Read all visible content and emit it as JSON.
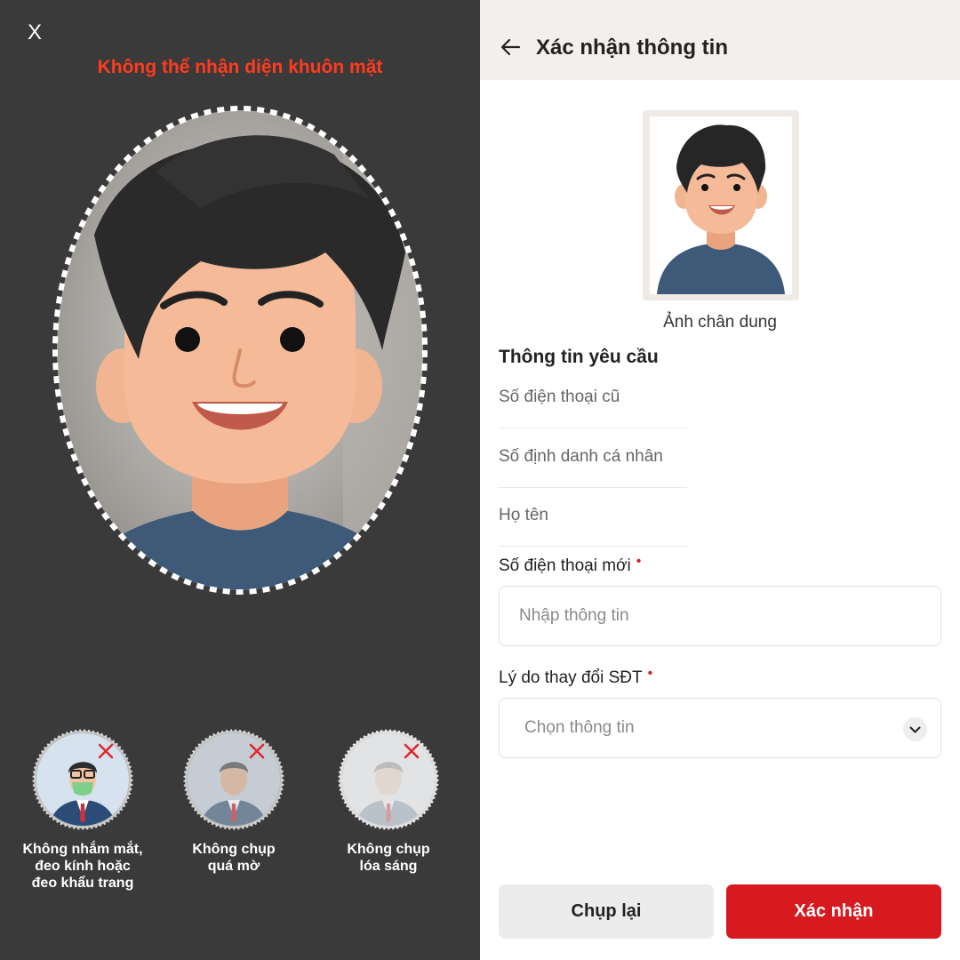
{
  "capture": {
    "close_label": "X",
    "error_message": "Không thể nhận diện khuôn mặt",
    "tips": [
      {
        "label_lines": [
          "Không nhắm mắt,",
          "đeo kính hoặc",
          "đeo khẩu trang"
        ],
        "icon": "masked-person-icon"
      },
      {
        "label_lines": [
          "Không chụp",
          "quá mờ"
        ],
        "icon": "blurry-person-icon"
      },
      {
        "label_lines": [
          "Không chụp",
          "lóa sáng"
        ],
        "icon": "glare-person-icon"
      }
    ]
  },
  "header": {
    "title": "Xác nhận thông tin",
    "back_icon": "arrow-left-icon"
  },
  "portrait": {
    "caption": "Ảnh chân dung"
  },
  "form": {
    "section_title": "Thông tin yêu cầu",
    "info_rows": [
      "Số điện thoại cũ",
      "Số định danh cá nhân",
      "Họ tên"
    ],
    "new_phone": {
      "label": "Số điện thoại mới",
      "required_mark": "•",
      "placeholder": "Nhập thông tin",
      "value": ""
    },
    "reason": {
      "label": "Lý do thay đổi SĐT",
      "required_mark": "•",
      "placeholder": "Chọn thông tin"
    }
  },
  "actions": {
    "retake_label": "Chụp lại",
    "confirm_label": "Xác nhận"
  },
  "colors": {
    "accent": "#d71920",
    "error": "#ff3b1f",
    "dark_bg": "#3a3a3a",
    "header_bg": "#f3efec"
  }
}
